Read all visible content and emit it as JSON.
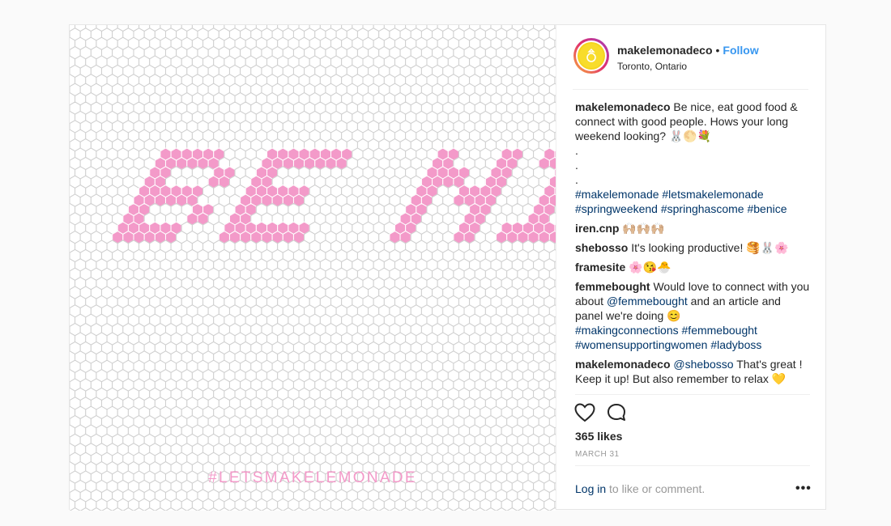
{
  "post": {
    "username": "makelemonadeco",
    "separator": "•",
    "follow_label": "Follow",
    "location": "Toronto, Ontario",
    "image": {
      "word": "BE NICE",
      "hashtag_overlay": "#LETSMAKELEMONADE",
      "colors": {
        "tile_fill": "#f39ac9",
        "grout": "#cfcfcf",
        "overlay_text": "#f39ac9"
      }
    },
    "comments": [
      {
        "user": "makelemonadeco",
        "text": "Be nice, eat good food & connect with good people. Hows your long weekend looking?",
        "emoji": "🐰🌕💐",
        "dots": [
          ".",
          ".",
          "."
        ],
        "hashtags": "#makelemonade #letsmakelemonade #springweekend #springhascome #benice"
      },
      {
        "user": "iren.cnp",
        "text": "",
        "emoji": "🙌🏼🙌🏼🙌🏼"
      },
      {
        "user": "shebosso",
        "text": "It's looking productive!",
        "emoji": "🥞🐰🌸"
      },
      {
        "user": "framesite",
        "text": "",
        "emoji": "🌸😘🐣"
      },
      {
        "user": "femmebought",
        "text_a": "Would love to connect with you about",
        "mention": "@femmebought",
        "text_b": "and an article and panel we're doing",
        "emoji": "😊",
        "hashtags": "#makingconnections #femmebought #womensupportingwomen #ladyboss"
      },
      {
        "user": "makelemonadeco",
        "mention": "@shebosso",
        "text": "That's great ! Keep it up! But also remember to relax",
        "emoji": "💛"
      }
    ],
    "actions": {
      "like_icon": "heart-icon",
      "comment_icon": "comment-icon"
    },
    "likes": "365 likes",
    "date": "MARCH 31",
    "footer": {
      "login_link": "Log in",
      "login_rest": "to like or comment.",
      "more_icon": "•••"
    },
    "colors": {
      "link": "#3897f0",
      "hashtag": "#003569",
      "muted": "#999999"
    }
  }
}
